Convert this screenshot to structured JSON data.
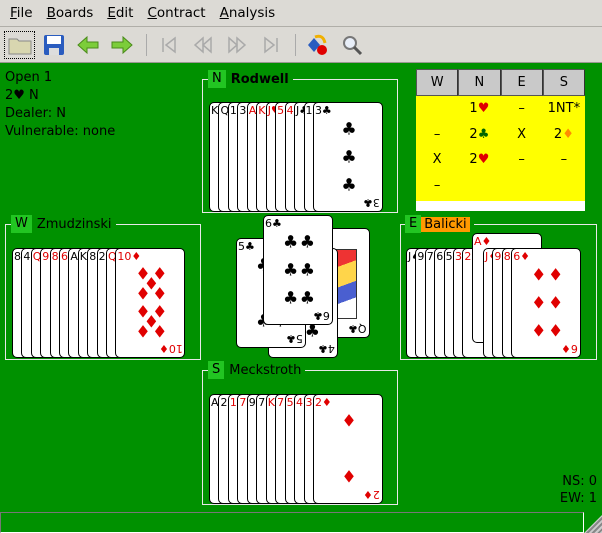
{
  "menu": [
    "File",
    "Boards",
    "Edit",
    "Contract",
    "Analysis"
  ],
  "toolbar": [
    {
      "icon": "open-folder-icon"
    },
    {
      "icon": "save-icon"
    },
    {
      "icon": "back-arrow-icon"
    },
    {
      "icon": "forward-arrow-icon"
    },
    {
      "icon": "first-icon"
    },
    {
      "icon": "rewind-icon"
    },
    {
      "icon": "fast-forward-icon"
    },
    {
      "icon": "last-icon"
    },
    {
      "icon": "deal-icon"
    },
    {
      "icon": "search-icon"
    }
  ],
  "info": {
    "line1": "Open 1",
    "line2": "2♥ N",
    "dealer": "Dealer: N",
    "vulnerable": "Vulnerable: none"
  },
  "hands": {
    "north": {
      "seat": "N",
      "player": "Rodwell",
      "cards": [
        "K♠",
        "Q♠",
        "10♠",
        "3♠",
        "A♥",
        "K♥",
        "J♥",
        "5♥",
        "4♥",
        "J♣",
        "10♣",
        "3♣"
      ]
    },
    "west": {
      "seat": "W",
      "player": "Zmudzinski",
      "cards": [
        "8♠",
        "4♠",
        "Q♥",
        "9♥",
        "8♥",
        "6♥",
        "A♣",
        "K♣",
        "8♣",
        "2♣",
        "Q♦",
        "10♦"
      ]
    },
    "east": {
      "seat": "E",
      "player": "Balicki",
      "cards": [
        "J♠",
        "9♠",
        "7♠",
        "6♠",
        "5♠",
        "3♥",
        "2♥",
        "J♦",
        "9♦",
        "8♦",
        "6♦"
      ],
      "raised_card": "A♦"
    },
    "south": {
      "seat": "S",
      "player": "Meckstroth",
      "cards": [
        "A♠",
        "2♠",
        "10♥",
        "7♥",
        "9♣",
        "7♣",
        "K♦",
        "7♦",
        "5♦",
        "4♦",
        "3♦",
        "2♦"
      ]
    }
  },
  "trick": {
    "west": "5♣",
    "south": "4♣",
    "east": "Q♣",
    "north": "6♣"
  },
  "bidding": {
    "headers": [
      "W",
      "N",
      "E",
      "S"
    ],
    "rows": [
      [
        "",
        "1♥",
        "–",
        "1NT*"
      ],
      [
        "–",
        "2♣",
        "X",
        "2♦"
      ],
      [
        "X",
        "2♥",
        "–",
        "–"
      ],
      [
        "–",
        "",
        "",
        ""
      ]
    ]
  },
  "score": {
    "ns": "NS: 0",
    "ew": "EW: 1"
  },
  "colors": {
    "table": "#009100",
    "active_seat": "#22c522",
    "turn_seat": "#ff9900",
    "bid_bg": "#ffff00",
    "red_suit": "#e00000"
  }
}
